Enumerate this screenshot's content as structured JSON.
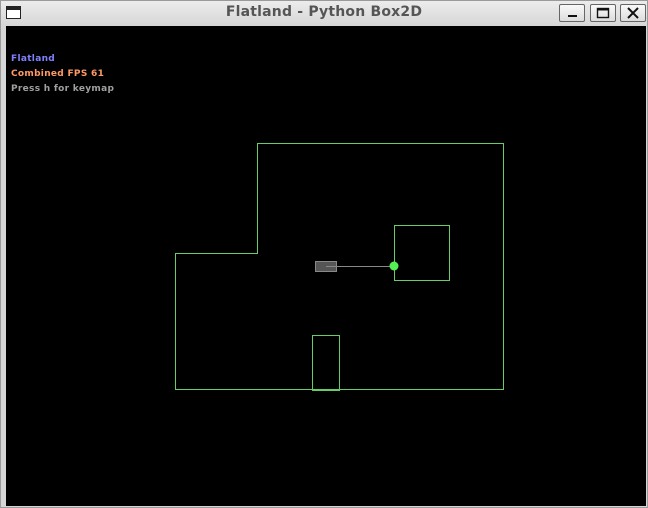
{
  "window": {
    "title": "Flatland - Python Box2D"
  },
  "hud": {
    "title_text": "Flatland",
    "title_color": "#8080ff",
    "fps_text": "Combined FPS 61",
    "fps_color": "#ff9966",
    "hint_text": "Press h for keymap",
    "hint_color": "#a0a0a0"
  },
  "scene": {
    "background": "#000000",
    "wall_color": "#66cc66",
    "body_fill": "#555555",
    "body_outline": "#888888",
    "joint_color": "#55ee55"
  },
  "icons": {
    "minimize": "minimize-icon",
    "maximize": "maximize-icon",
    "close": "close-icon",
    "app": "window-app-icon"
  }
}
